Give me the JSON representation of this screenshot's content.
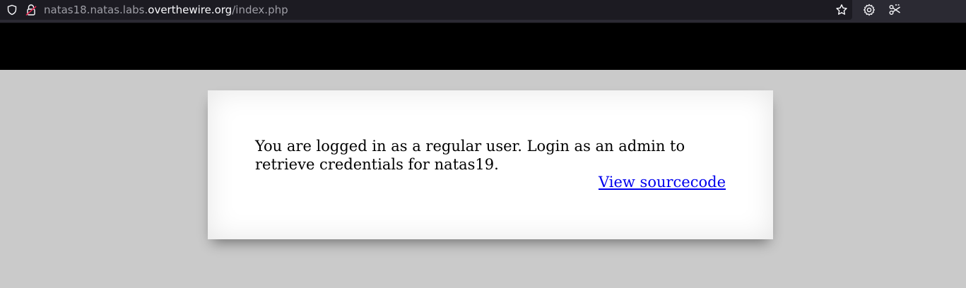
{
  "browser": {
    "url_prefix": "natas18.natas.labs.",
    "url_domain": "overthewire.org",
    "url_path": "/index.php",
    "icons": [
      "shield-icon",
      "lock-warning-icon",
      "bookmark-star-icon",
      "settings-gear-icon",
      "extension-icon"
    ]
  },
  "page": {
    "message": "You are logged in as a regular user. Login as an admin to retrieve credentials for natas19.",
    "source_link": "View sourcecode"
  },
  "colors": {
    "page_background": "#cacaca",
    "header_band": "#000000",
    "card_background": "#ffffff",
    "link": "#0000ee"
  }
}
